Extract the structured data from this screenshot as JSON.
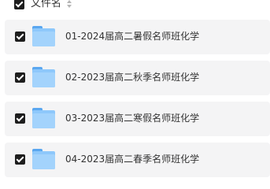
{
  "header": {
    "column_label": "文件名",
    "select_all_checked": true,
    "sort_icon": "sort-icon"
  },
  "files": [
    {
      "name": "01-2024届高二暑假名师班化学",
      "checked": true,
      "icon": "folder-icon"
    },
    {
      "name": "02-2023届高二秋季名师班化学",
      "checked": true,
      "icon": "folder-icon"
    },
    {
      "name": "03-2023届高二寒假名师班化学",
      "checked": true,
      "icon": "folder-icon"
    },
    {
      "name": "04-2023届高二春季名师班化学",
      "checked": true,
      "icon": "folder-icon"
    }
  ],
  "colors": {
    "row_background": "#f4f4f5",
    "checkbox": "#1e1e1e",
    "folder": "#8ec8fb"
  }
}
